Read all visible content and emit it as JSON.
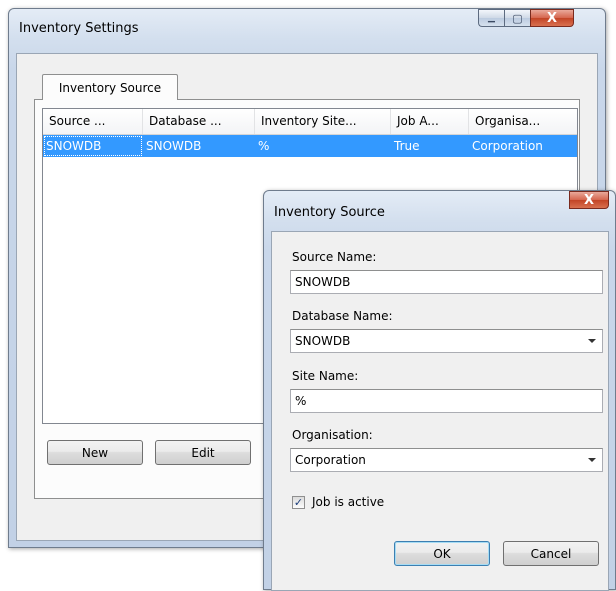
{
  "main_window": {
    "title": "Inventory Settings",
    "tab_label": "Inventory Source",
    "columns": [
      "Source ...",
      "Database ...",
      "Inventory Site...",
      "Job A...",
      "Organisa..."
    ],
    "rows": [
      [
        "SNOWDB",
        "SNOWDB",
        "%",
        "True",
        "Corporation"
      ]
    ],
    "buttons": {
      "new_label": "New",
      "edit_label": "Edit"
    },
    "caption": {
      "min_glyph": "▁",
      "max_glyph": "▢",
      "close_glyph": "X"
    }
  },
  "dialog": {
    "title": "Inventory Source",
    "close_glyph": "X",
    "source_name_label": "Source Name:",
    "source_name_value": "SNOWDB",
    "database_name_label": "Database Name:",
    "database_name_value": "SNOWDB",
    "site_name_label": "Site Name:",
    "site_name_value": "%",
    "organisation_label": "Organisation:",
    "organisation_value": "Corporation",
    "job_active_label": "Job is active",
    "job_active_checked": true,
    "ok_label": "OK",
    "cancel_label": "Cancel"
  },
  "colors": {
    "selection": "#3399ff",
    "close_button": "#c24426",
    "chrome": "#c9d7ea"
  }
}
